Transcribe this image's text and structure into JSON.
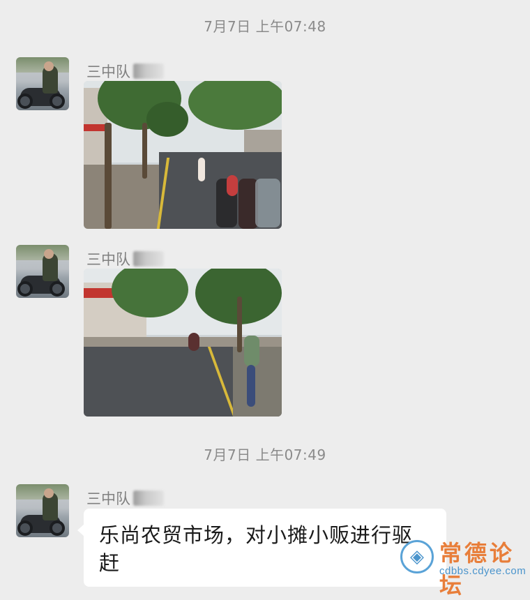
{
  "timestamps": [
    "7月7日 上午07:48",
    "7月7日 上午07:49"
  ],
  "messages": [
    {
      "sender": "三中队",
      "type": "image"
    },
    {
      "sender": "三中队",
      "type": "image"
    },
    {
      "sender": "三中队",
      "type": "text",
      "text": "乐尚农贸市场，对小摊小贩进行驱赶"
    }
  ],
  "watermark": {
    "title": "常德论坛",
    "url": "cdbbs.cdyee.com"
  }
}
